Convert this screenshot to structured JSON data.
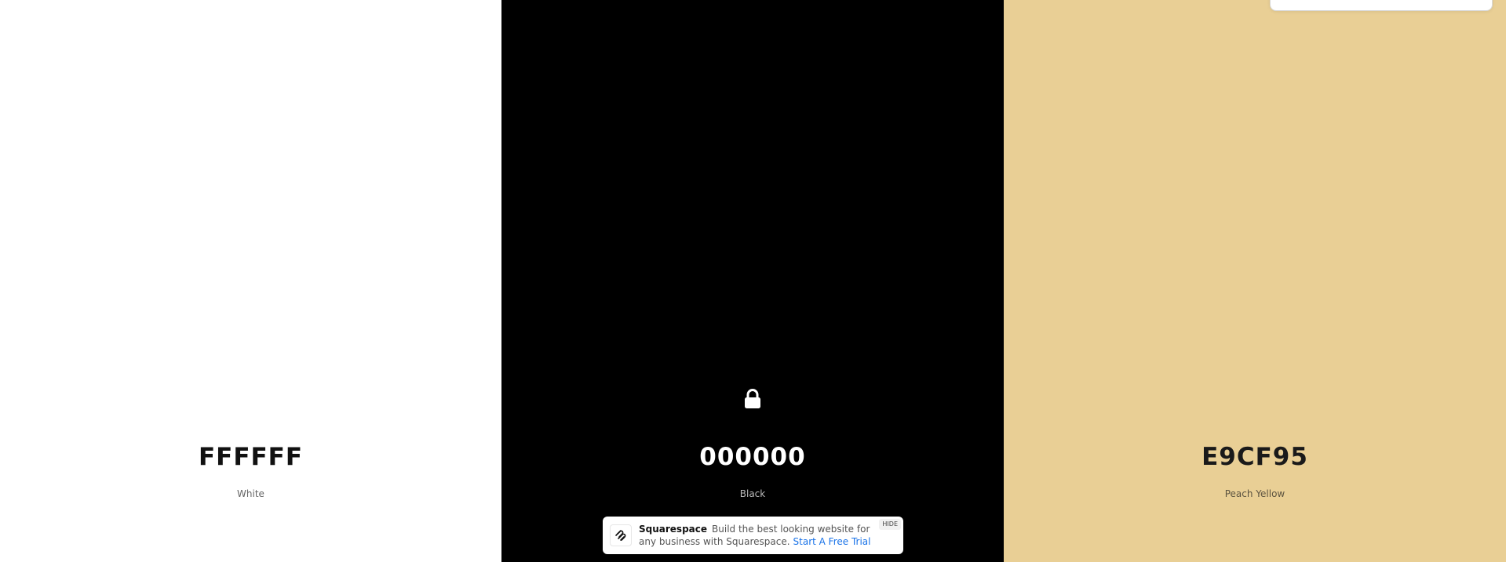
{
  "palette": {
    "swatches": [
      {
        "hex": "FFFFFF",
        "name": "White",
        "background": "#FFFFFF",
        "hex_color": "#111111",
        "name_color": "#666666",
        "locked": false
      },
      {
        "hex": "000000",
        "name": "Black",
        "background": "#000000",
        "hex_color": "#FFFFFF",
        "name_color": "#BBBBBB",
        "locked": true,
        "lock_icon": "lock-icon"
      },
      {
        "hex": "E9CF95",
        "name": "Peach Yellow",
        "background": "#E9CF95",
        "hex_color": "#1A1A1A",
        "name_color": "#5C5340",
        "locked": false
      }
    ]
  },
  "ad": {
    "brand": "Squarespace",
    "text": "Build the best looking website for any business with Squarespace.",
    "cta": "Start A Free Trial",
    "hide_label": "HIDE",
    "logo_icon": "squarespace-logo-icon",
    "cta_color": "#1A73E8"
  }
}
